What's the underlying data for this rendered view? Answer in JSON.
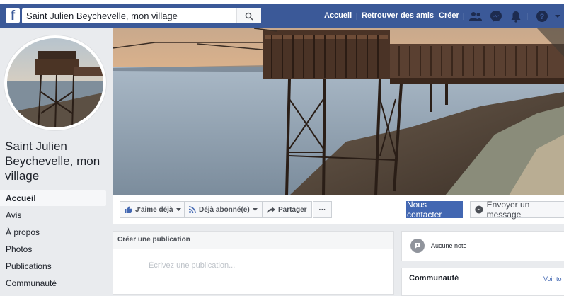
{
  "topbar": {
    "logo": "f",
    "search_value": "Saint Julien Beychevelle, mon village",
    "nav": {
      "home": "Accueil",
      "find_friends": "Retrouver des amis",
      "create": "Créer"
    }
  },
  "page": {
    "name": "Saint Julien Beychevelle, mon village"
  },
  "sidebar": {
    "items": [
      {
        "label": "Accueil",
        "active": true
      },
      {
        "label": "Avis"
      },
      {
        "label": "À propos"
      },
      {
        "label": "Photos"
      },
      {
        "label": "Publications"
      },
      {
        "label": "Communauté"
      }
    ]
  },
  "actions": {
    "like": "J'aime déjà",
    "follow": "Déjà abonné(e)",
    "share": "Partager",
    "more": "···",
    "contact": "Nous contacter",
    "message": "Envoyer un message"
  },
  "composer": {
    "header": "Créer une publication",
    "placeholder": "Écrivez une publication..."
  },
  "right": {
    "rating": "Aucune note",
    "community_title": "Communauté",
    "community_link": "Voir to"
  },
  "colors": {
    "brand": "#3b5998",
    "button_blue": "#4267b2",
    "background": "#e9ebee"
  },
  "icons": [
    "search-icon",
    "friends-icon",
    "messenger-icon",
    "bell-icon",
    "help-icon",
    "chevron-down-icon",
    "like-icon",
    "rss-icon",
    "share-icon",
    "messenger-small-icon",
    "note-icon"
  ]
}
